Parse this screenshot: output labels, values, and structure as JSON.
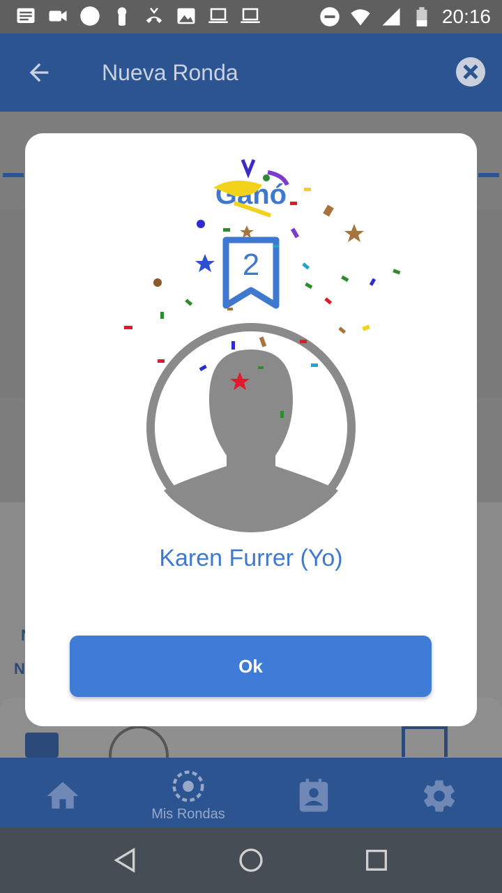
{
  "status_bar": {
    "time": "20:16",
    "left_icons": [
      "message-icon",
      "video-icon",
      "circle-icon",
      "keyhole-icon",
      "call-icon",
      "image-icon",
      "laptop-icon",
      "laptop-icon"
    ],
    "right_icons": [
      "do-not-disturb-icon",
      "wifi-icon",
      "signal-icon",
      "battery-icon"
    ]
  },
  "app_bar": {
    "title": "Nueva Ronda",
    "back_icon": "arrow-back-icon",
    "close_icon": "close-circle-icon"
  },
  "dialog": {
    "title": "Ganó",
    "rank": "2",
    "winner_name": "Karen Furrer (Yo)",
    "ok_label": "Ok"
  },
  "bottom_nav": {
    "items": [
      {
        "icon": "home-icon",
        "label": ""
      },
      {
        "icon": "rondas-icon",
        "label": "Mis Rondas"
      },
      {
        "icon": "contact-calendar-icon",
        "label": ""
      },
      {
        "icon": "settings-icon",
        "label": ""
      }
    ]
  },
  "colors": {
    "primary": "#2b5491",
    "accent": "#3f7cd8",
    "text_blue": "#3f78cf"
  }
}
